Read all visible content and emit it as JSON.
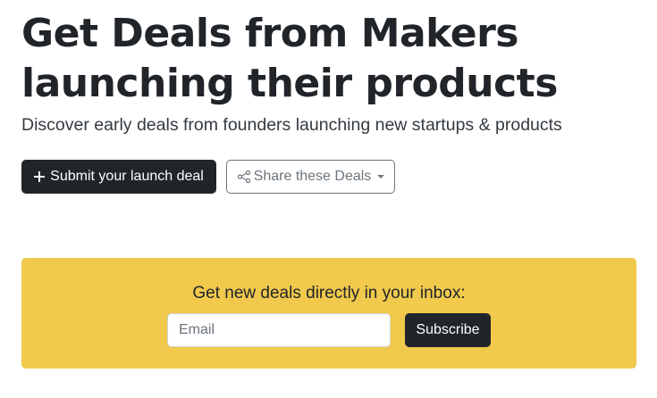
{
  "hero": {
    "title": "Get Deals from Makers launching their products",
    "subtitle": "Discover early deals from founders launching new startups & products"
  },
  "actions": {
    "submit_label": "Submit your launch deal",
    "submit_icon": "plus-icon",
    "share_label": "Share these Deals",
    "share_icon": "share-icon",
    "share_dropdown_icon": "caret-down-icon"
  },
  "newsletter": {
    "heading": "Get new deals directly in your inbox:",
    "email_placeholder": "Email",
    "email_value": "",
    "subscribe_label": "Subscribe",
    "background_color": "#f0c94d"
  },
  "colors": {
    "primary_button": "#212529",
    "outline_button": "#6c757d"
  }
}
